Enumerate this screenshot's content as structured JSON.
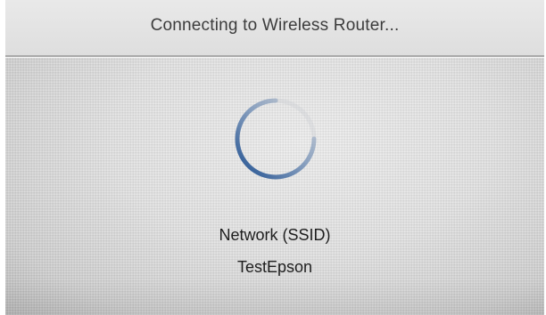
{
  "screen": {
    "title": "Connecting to Wireless Router...",
    "spinner_icon": "loading-spinner-icon",
    "network_label": "Network (SSID)",
    "network_value": "TestEpson"
  },
  "colors": {
    "spinner": "#1f4f8f",
    "title_text": "#3c3c3c",
    "body_text": "#1e1e1e",
    "background": "#e2e2e2"
  }
}
